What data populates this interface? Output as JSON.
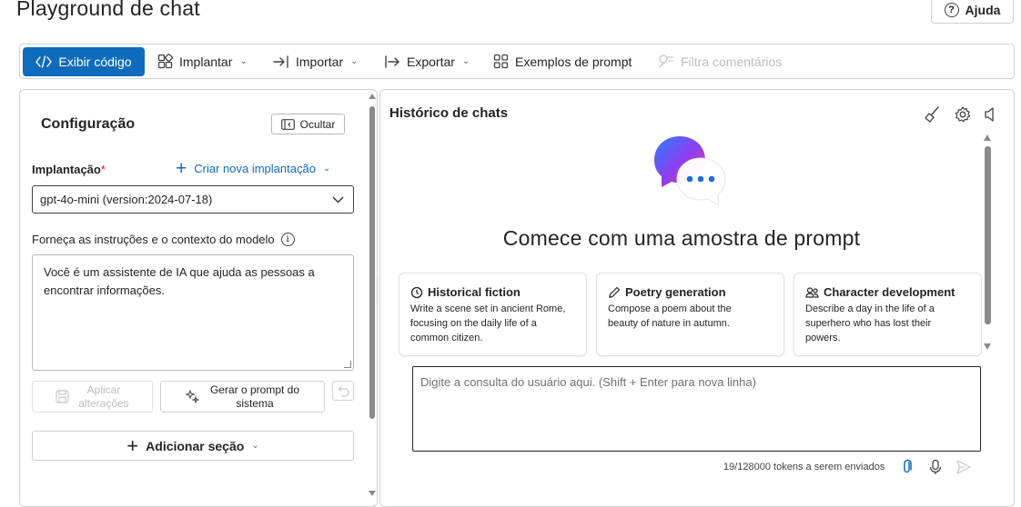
{
  "page": {
    "title": "Playground de chat",
    "help_label": "Ajuda"
  },
  "toolbar": {
    "view_code": "Exibir código",
    "deploy": "Implantar",
    "import": "Importar",
    "export": "Exportar",
    "prompt_examples": "Exemplos de prompt",
    "filter_comments": "Filtra comentários"
  },
  "config": {
    "title": "Configuração",
    "hide_label": "Ocultar",
    "deployment_label": "Implantação",
    "required_mark": "*",
    "create_deployment": "Criar nova implantação",
    "deployment_value": "gpt-4o-mini (version:2024-07-18)",
    "instructions_label": "Forneça as instruções e o contexto do modelo",
    "instructions_value": "Você é um assistente de IA que ajuda as pessoas a encontrar informações.",
    "apply_label_1": "Aplicar",
    "apply_label_2": "alterações",
    "generate_label_1": "Gerar o prompt do",
    "generate_label_2": "sistema",
    "add_section": "Adicionar seção"
  },
  "chat": {
    "history_title": "Histórico de chats",
    "hero_title": "Comece com uma amostra de prompt",
    "cards": [
      {
        "title": "Historical fiction",
        "icon": "history-icon",
        "desc_1": "Write a scene set in ancient Rome,",
        "desc_2": "focusing on the daily life of a",
        "desc_3": "common citizen."
      },
      {
        "title": "Poetry generation",
        "icon": "pen-icon",
        "desc_1": "Compose a poem about the",
        "desc_2": "beauty of nature in autumn.",
        "desc_3": ""
      },
      {
        "title": "Character development",
        "icon": "people-icon",
        "desc_1": "Describe a day in the life of a",
        "desc_2": "superhero who has lost their",
        "desc_3": "powers."
      }
    ],
    "query_placeholder": "Digite a consulta do usuário aqui. (Shift + Enter para nova linha)",
    "tokens_text": "19/128000 tokens a serem enviados"
  },
  "colors": {
    "accent": "#0f6cbd",
    "border": "#d1d1d1",
    "disabled": "#bdbdbd"
  }
}
